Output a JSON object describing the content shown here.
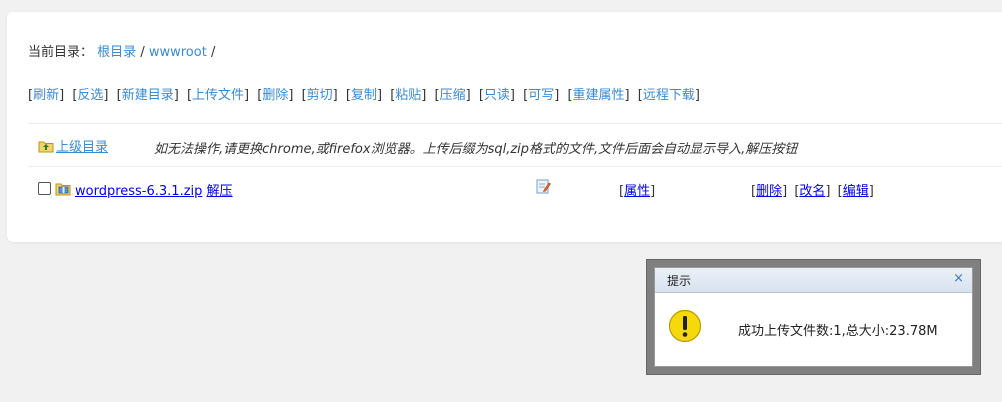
{
  "breadcrumb": {
    "label": "当前目录：",
    "root": "根目录",
    "separator": "/",
    "current": "wwwroot",
    "trailing": "/"
  },
  "toolbar": {
    "items": [
      "刷新",
      "反选",
      "新建目录",
      "上传文件",
      "删除",
      "剪切",
      "复制",
      "粘贴",
      "压缩",
      "只读",
      "可写",
      "重建属性",
      "远程下载"
    ]
  },
  "file_list": {
    "parent_link": "上级目录",
    "notice": "如无法操作,请更换chrome,或firefox浏览器。上传后缀为sql,zip格式的文件,文件后面会自动显示导入,解压按钮",
    "files": [
      {
        "name": "wordpress-6.3.1.zip",
        "action": "解压",
        "props_label": "属性",
        "ops": [
          "删除",
          "改名",
          "编辑"
        ]
      }
    ]
  },
  "dialog": {
    "title": "提示",
    "close": "×",
    "message": "成功上传文件数:1,总大小:23.78M"
  },
  "colors": {
    "link": "#3a8ad0",
    "warning": "#f5d90a"
  }
}
